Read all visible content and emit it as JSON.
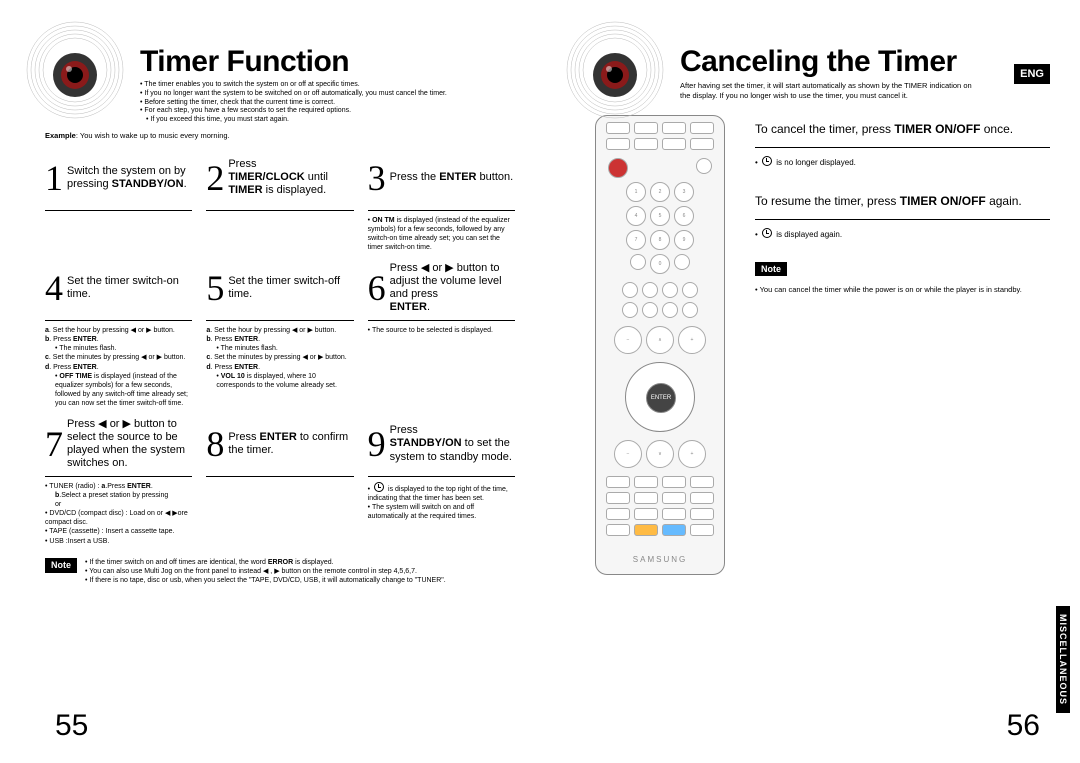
{
  "left": {
    "title": "Timer Function",
    "intro": [
      "The timer enables you to switch the system on or off at specific times.",
      "If you no longer want the system to be switched on or off automatically, you must cancel the timer.",
      "Before setting the timer, check that the current time is correct.",
      "For each step, you have a few seconds to set the required options.",
      "If you exceed this time, you must start again."
    ],
    "example_label": "Example",
    "example_text": ": You wish to wake up to music every morning.",
    "steps": {
      "s1": {
        "num": "1",
        "textA": "Switch the system on by pressing ",
        "bold": "STANDBY/ON",
        "textB": "."
      },
      "s2": {
        "num": "2",
        "pre": "Press",
        "bold1": "TIMER/CLOCK",
        "mid": " until ",
        "bold2": "TIMER",
        "end": " is displayed."
      },
      "s3": {
        "num": "3",
        "textA": "Press the ",
        "bold": "ENTER",
        "textB": " button."
      },
      "s4": {
        "num": "4",
        "text": "Set the timer switch-on time."
      },
      "s5": {
        "num": "5",
        "text": "Set the timer switch-off time."
      },
      "s6": {
        "num": "6",
        "textA": "Press ◀ or ▶ button to adjust the volume level and press ",
        "bold": "ENTER",
        "textB": "."
      },
      "s7": {
        "num": "7",
        "text": "Press ◀ or ▶ button to select the source to be played when the system switches on."
      },
      "s8": {
        "num": "8",
        "textA": "Press ",
        "bold": "ENTER",
        "textB": " to confirm the timer."
      },
      "s9": {
        "num": "9",
        "pre": "Press",
        "bold": "STANDBY/ON",
        "end": " to set the system to standby mode."
      }
    },
    "bodies": {
      "s3": [
        "ON TM is displayed (instead of the equalizer symbols) for a few seconds, followed by any switch-on time already set; you can set the timer switch-on time."
      ],
      "s4": {
        "a": "Set the hour by pressing ◀ or ▶ button.",
        "b": "Press ENTER.",
        "b_sub": "The minutes flash.",
        "c": "Set the minutes by pressing ◀ or ▶ button.",
        "d": "Press ENTER.",
        "d_sub": "OFF TIME is displayed (instead of the equalizer symbols) for a few seconds, followed by any switch-off time already set; you can now set the timer switch-off time."
      },
      "s5": {
        "a": "Set the hour by pressing ◀ or ▶ button.",
        "b": "Press ENTER.",
        "b_sub": "The minutes flash.",
        "c": "Set the minutes by pressing ◀ or ▶ button.",
        "d": "Press ENTER.",
        "d_sub": "VOL 10 is displayed, where 10 corresponds to the volume already set."
      },
      "s6": "The source to be selected is displayed.",
      "s7": {
        "l1": "TUNER (radio) : a.Press ENTER.",
        "l1b": "b.Select a preset station by pressing or",
        "l2": "DVD/CD (compact disc) : Load on or ◀ ▶ore compact disc.",
        "l3": "TAPE (cassette) : Insert a cassette tape.",
        "l4": "USB :Insert a USB."
      },
      "s9": [
        "⏲ is displayed to the top right of the time, indicating that the timer has been set.",
        "The system will switch on and off automatically at the required times."
      ]
    },
    "note_label": "Note",
    "note_items": [
      "If the timer switch on and off times are identical, the word ERROR is displayed.",
      "You can also use Multi Jog on the front panel to instead ◀ , ▶ button on the remote control in step 4,5,6,7.",
      "If there is no tape, disc or usb, when you select the \"TAPE, DVD/CD, USB, it will automatically change to \"TUNER\"."
    ],
    "page_num": "55"
  },
  "right": {
    "title": "Canceling the Timer",
    "lang": "ENG",
    "intro": "After having set the timer, it will start automatically as shown by the TIMER indication on the display. If you no longer wish to use the timer, you must cancel it.",
    "cancel": {
      "a": "To cancel the timer, press ",
      "b": "TIMER ON/OFF",
      "c": " once."
    },
    "cancel_sub": " is no longer displayed.",
    "resume": {
      "a": "To resume the timer, press ",
      "b": "TIMER ON/OFF",
      "c": " again."
    },
    "resume_sub": " is displayed again.",
    "note_label": "Note",
    "note_text": "You can cancel the timer while the power is on or while the player is in standby.",
    "side_tab": "MISCELLANEOUS",
    "page_num": "56",
    "remote": {
      "enter": "ENTER",
      "brand": "SAMSUNG"
    }
  }
}
